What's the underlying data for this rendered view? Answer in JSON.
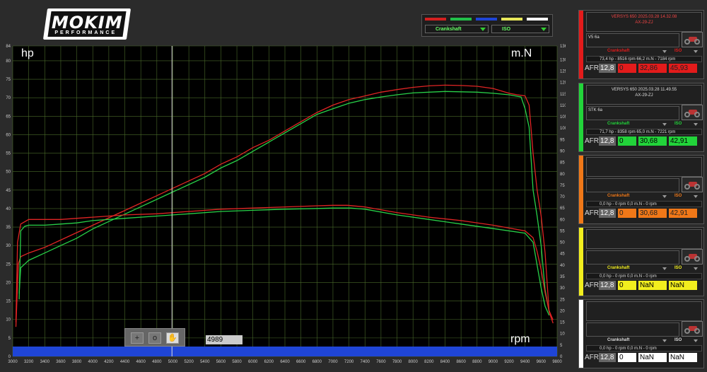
{
  "logo": {
    "main": "MOKIM",
    "sub": "PERFORMANCE"
  },
  "legend": {
    "swatch_colors": [
      "#d42020",
      "#22c04a",
      "#1f45d6",
      "#e8e85a",
      "#ffffff"
    ],
    "select1": "Crankshaft",
    "select2": "ISO"
  },
  "chart_labels": {
    "left_unit": "hp",
    "right_unit": "m.N",
    "x_unit": "rpm"
  },
  "cursor_value": "4989",
  "toolbar": {
    "zoom_in": "+",
    "zoom_reset": "o",
    "pan": "✋"
  },
  "panels": [
    {
      "color": "#e31b1b",
      "header_title": "VERSYS 650   2025.03.28 14.32.08",
      "header_sub": "AX-29-ZJ",
      "note": "V5 6a",
      "select_a": "Crankshaft",
      "select_b": "ISO",
      "info": "73,4 hp - 8516 rpm      66,2 m.N - 7184 rpm",
      "afr_label": "AFR",
      "afr": "12,8",
      "v1": "0",
      "v2": "32,86",
      "v3": "45,93"
    },
    {
      "color": "#22d43a",
      "header_title": "VERSYS 650   2025.03.28 11.49.55",
      "header_sub": "AX-29-ZJ",
      "note": "STK 6a",
      "select_a": "Crankshaft",
      "select_b": "ISO",
      "info": "71,7 hp - 8358 rpm      65,0 m.N - 7221 rpm",
      "afr_label": "AFR",
      "afr": "12,8",
      "v1": "0",
      "v2": "30,68",
      "v3": "42,91"
    },
    {
      "color": "#f07818",
      "header_title": "",
      "header_sub": "",
      "note": "",
      "select_a": "Crankshaft",
      "select_b": "ISO",
      "info": "0,0 hp - 0 rpm      0,0 m.N - 0 rpm",
      "afr_label": "AFR",
      "afr": "12,8",
      "v1": "0",
      "v2": "30,68",
      "v3": "42,91"
    },
    {
      "color": "#f2ee1e",
      "header_title": "",
      "header_sub": "",
      "note": "",
      "select_a": "Crankshaft",
      "select_b": "ISO",
      "info": "0,0 hp - 0 rpm      0,0 m.N - 0 rpm",
      "afr_label": "AFR",
      "afr": "12,8",
      "v1": "0",
      "v2": "NaN",
      "v3": "NaN"
    },
    {
      "color": "#ffffff",
      "header_title": "",
      "header_sub": "",
      "note": "",
      "select_a": "Crankshaft",
      "select_b": "ISO",
      "info": "0,0 hp - 0 rpm      0,0 m.N - 0 rpm",
      "afr_label": "AFR",
      "afr": "12,8",
      "v1": "0",
      "v2": "NaN",
      "v3": "NaN"
    }
  ],
  "chart_data": {
    "type": "line",
    "xlabel": "rpm",
    "ylabel": "hp",
    "y2label": "m.N",
    "xlim": [
      3000,
      9800
    ],
    "ylim": [
      0,
      84
    ],
    "y2lim": [
      0,
      136
    ],
    "x_ticks": [
      3000,
      3200,
      3400,
      3600,
      3800,
      4000,
      4200,
      4400,
      4600,
      4800,
      5000,
      5200,
      5400,
      5600,
      5800,
      6000,
      6200,
      6400,
      6600,
      6800,
      7000,
      7200,
      7400,
      7600,
      7800,
      8000,
      8200,
      8400,
      8600,
      8800,
      9000,
      9200,
      9400,
      9600,
      9800
    ],
    "y_ticks": [
      0,
      5,
      10,
      15,
      20,
      25,
      30,
      35,
      40,
      45,
      50,
      55,
      60,
      65,
      70,
      75,
      80,
      84
    ],
    "y2_ticks": [
      0,
      5,
      10,
      15,
      20,
      25,
      30,
      35,
      40,
      45,
      50,
      55,
      60,
      65,
      70,
      75,
      80,
      85,
      90,
      95,
      100,
      105,
      110,
      115,
      120,
      125,
      130,
      136
    ],
    "cursor_rpm": 4989,
    "series": [
      {
        "axis": "hp",
        "color": "#e02424",
        "x": [
          3040,
          3070,
          3100,
          3200,
          3400,
          3600,
          3800,
          4000,
          4200,
          4400,
          4600,
          4800,
          5000,
          5200,
          5400,
          5600,
          5800,
          6000,
          6200,
          6400,
          6600,
          6800,
          7000,
          7200,
          7400,
          7600,
          7800,
          8000,
          8200,
          8400,
          8600,
          8800,
          9000,
          9200,
          9300,
          9400,
          9450,
          9500,
          9550,
          9600,
          9650,
          9700,
          9750
        ],
        "y": [
          8,
          25,
          27,
          28,
          29.5,
          31.5,
          33.5,
          35.5,
          37.5,
          39.5,
          41.5,
          43.5,
          45.5,
          47.5,
          49.5,
          52,
          54,
          56.5,
          58.5,
          61,
          63.5,
          66,
          68,
          69.5,
          70.5,
          71.5,
          72.2,
          72.8,
          73.2,
          73.4,
          73.3,
          73.1,
          72.5,
          71.2,
          70.8,
          70.5,
          68,
          55,
          45,
          38,
          28,
          12,
          9
        ]
      },
      {
        "axis": "hp",
        "color": "#28d048",
        "x": [
          3080,
          3100,
          3150,
          3200,
          3400,
          3600,
          3800,
          4000,
          4200,
          4400,
          4600,
          4800,
          5000,
          5200,
          5400,
          5600,
          5800,
          6000,
          6200,
          6400,
          6600,
          6800,
          7000,
          7200,
          7400,
          7600,
          7800,
          8000,
          8200,
          8400,
          8600,
          8800,
          9000,
          9200,
          9350,
          9400,
          9450,
          9500,
          9550,
          9600,
          9650,
          9700
        ],
        "y": [
          17,
          24,
          25,
          26,
          28,
          30,
          32,
          34.5,
          36.5,
          38.5,
          40.5,
          42.5,
          44.5,
          46.5,
          48.5,
          51,
          53,
          55.5,
          58,
          60.5,
          63,
          65.5,
          67,
          68.5,
          69.5,
          70.2,
          70.8,
          71.3,
          71.5,
          71.7,
          71.6,
          71.5,
          71.2,
          70.8,
          70.2,
          67,
          62,
          45,
          38,
          30,
          18,
          12
        ]
      },
      {
        "axis": "m.N",
        "color": "#e02424",
        "x": [
          3040,
          3060,
          3100,
          3200,
          3400,
          3600,
          3800,
          4000,
          4400,
          4800,
          5200,
          5600,
          6000,
          6400,
          6800,
          7000,
          7184,
          7400,
          7800,
          8200,
          8600,
          9000,
          9400,
          9500,
          9550,
          9600,
          9650,
          9700,
          9750
        ],
        "y": [
          15,
          50,
          58,
          60,
          60,
          60,
          60.5,
          61,
          62,
          62.5,
          63.5,
          64.5,
          65,
          65.5,
          66,
          66.2,
          66.2,
          65.5,
          63,
          61,
          59.5,
          57.5,
          55,
          52,
          46,
          38,
          28,
          20,
          16
        ]
      },
      {
        "axis": "m.N",
        "color": "#28d048",
        "x": [
          3080,
          3100,
          3150,
          3200,
          3400,
          3600,
          3800,
          4000,
          4400,
          4800,
          5200,
          5600,
          6000,
          6400,
          6800,
          7000,
          7221,
          7400,
          7800,
          8200,
          8600,
          9000,
          9400,
          9500,
          9550,
          9600,
          9650,
          9700
        ],
        "y": [
          25,
          55,
          57,
          57.5,
          57.5,
          58,
          58.5,
          59.5,
          60.5,
          61.5,
          62.5,
          63.5,
          64,
          64.5,
          64.8,
          65,
          65,
          64.5,
          62,
          60,
          58,
          56,
          54,
          50,
          40,
          30,
          22,
          18
        ]
      }
    ]
  }
}
